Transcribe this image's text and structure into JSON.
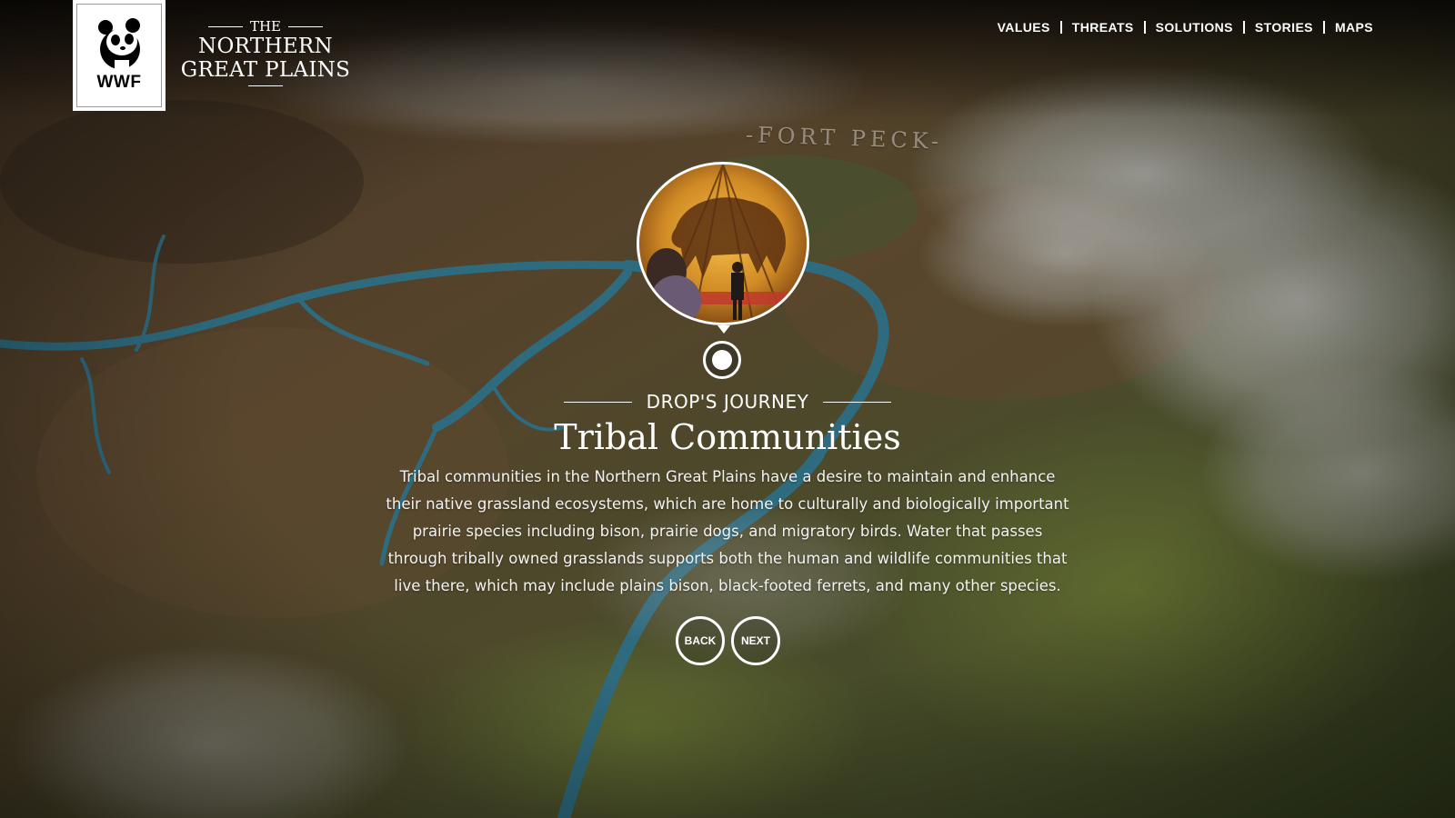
{
  "header": {
    "logo": {
      "text": "WWF",
      "icon": "panda-icon"
    },
    "site_title": {
      "the": "THE",
      "line1": "NORTHERN",
      "line2": "GREAT PLAINS"
    }
  },
  "nav": {
    "items": [
      {
        "label": "VALUES"
      },
      {
        "label": "THREATS"
      },
      {
        "label": "SOLUTIONS"
      },
      {
        "label": "STORIES"
      },
      {
        "label": "MAPS"
      }
    ]
  },
  "map": {
    "place_label": "-FORT PECK-"
  },
  "story": {
    "eyebrow": "DROP'S JOURNEY",
    "title": "Tribal Communities",
    "body": "Tribal communities in the Northern Great Plains have a desire to maintain and enhance their native grassland ecosystems, which are home to culturally and biologically important prairie species including bison, prairie dogs, and migratory birds. Water that passes through tribally owned grasslands supports both the human and wildlife communities that live there, which may include plains bison, black-footed ferrets, and many other species.",
    "back_label": "BACK",
    "next_label": "NEXT"
  },
  "colors": {
    "river": "#3b8aa3",
    "terrain_brown": "#6b5238",
    "terrain_green": "#5f6a3a",
    "cloud": "#d8d8d4"
  }
}
